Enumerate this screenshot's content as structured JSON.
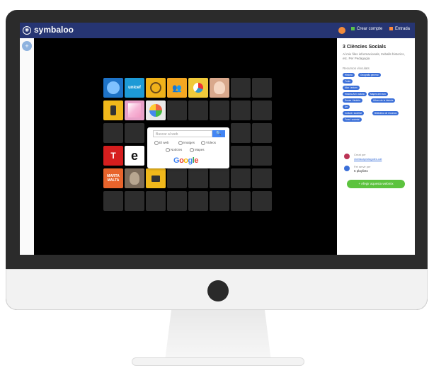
{
  "topbar": {
    "logo_icon": "◉",
    "logo_text": "symbaloo",
    "create_button": "Crear compte",
    "login_button": "Entrada"
  },
  "leftbar": {
    "add_icon": "+"
  },
  "tiles": [
    {
      "label": "",
      "color": "#1e73c8",
      "icon": "globe-icon"
    },
    {
      "label": "unicef",
      "color": "#1d9ad6",
      "icon": "unicef-logo"
    },
    {
      "label": "",
      "color": "#f0b21a",
      "icon": "map-icon"
    },
    {
      "label": "",
      "color": "#f4a722",
      "icon": "people-icon"
    },
    {
      "label": "",
      "color": "#f0c93a",
      "icon": "pie-chart-icon"
    },
    {
      "label": "",
      "color": "#d9a88c",
      "icon": "portrait-icon"
    },
    {
      "label": "",
      "color": "#f0b81b",
      "icon": "radio-icon"
    },
    {
      "label": "",
      "color": "#e8a1c8",
      "icon": "painting-icon"
    },
    {
      "label": "",
      "color": "#e9e9e9",
      "icon": "circle-chart-icon"
    },
    {
      "label": "T",
      "color": "#d61e1e",
      "icon": "t-logo"
    },
    {
      "label": "e",
      "color": "#ffffff",
      "icon": "e-logo"
    },
    {
      "label": "MARTA MALTA",
      "color": "#e8642c",
      "icon": "text-logo"
    },
    {
      "label": "",
      "color": "#7a6a5a",
      "icon": "portrait-icon"
    },
    {
      "label": "",
      "color": "#f0b81b",
      "icon": "briefcase-icon"
    }
  ],
  "search_widget": {
    "placeholder": "Buscar al web",
    "button_icon": "🔍",
    "options": [
      "El web",
      "Imatges",
      "Vídeos",
      "Notícies",
      "Mapes"
    ],
    "logo": {
      "G": "G",
      "o1": "o",
      "o2": "o",
      "g": "g",
      "l": "l",
      "e": "e"
    }
  },
  "right_panel": {
    "title": "3 Ciències Socials",
    "description": "Al mix files informacionals, treballs historics, etc. Per Pedagogia",
    "section_label": "Recursos vinculats",
    "tags": [
      "Historia",
      "Geografia general",
      "Fonts",
      "Mon i entorn",
      "Història Art i cultura",
      "Mapes del mon",
      "Dones i història",
      "Llibres de la historia",
      "Art",
      "Cultura i societat",
      "Biblioteca de recursos",
      "Fons i societat"
    ],
    "creator_label": "Creat per",
    "creator_link": "vivelacaprolagoles.cat",
    "used_label": "Fet servir per",
    "used_value": "5 playlists",
    "action_button": "+ Afegir aquesta webmix"
  },
  "colors": {
    "topbar": "#263573",
    "tag": "#3b6fd8",
    "action": "#5cc33e"
  }
}
